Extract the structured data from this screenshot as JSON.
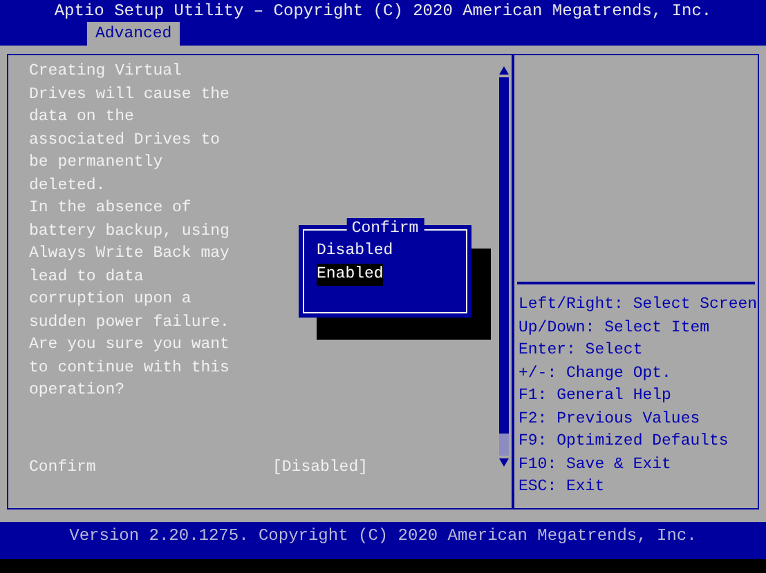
{
  "header": {
    "title": "Aptio Setup Utility – Copyright (C) 2020 American Megatrends, Inc.",
    "tabs": [
      {
        "label": "Advanced",
        "selected": true
      }
    ]
  },
  "help_text": [
    "Creating Virtual\nDrives will cause the\ndata on the\nassociated Drives to\nbe permanently\ndeleted.",
    "In the absence of\nbattery backup, using\nAlways Write Back may\nlead to data\ncorruption upon a\nsudden power failure.\nAre you sure you want\nto continue with this\noperation?"
  ],
  "setting": {
    "label": "Confirm",
    "value": "[Disabled]"
  },
  "popup": {
    "title": "Confirm",
    "options": [
      {
        "label": "Disabled",
        "selected": false
      },
      {
        "label": "Enabled",
        "selected": true
      }
    ]
  },
  "key_help": [
    "Left/Right: Select Screen",
    "Up/Down: Select Item",
    "Enter: Select",
    "+/-: Change Opt.",
    "F1: General Help",
    "F2: Previous Values",
    "F9: Optimized Defaults",
    "F10: Save & Exit",
    "ESC: Exit"
  ],
  "footer": "Version 2.20.1275. Copyright (C) 2020 American Megatrends, Inc."
}
